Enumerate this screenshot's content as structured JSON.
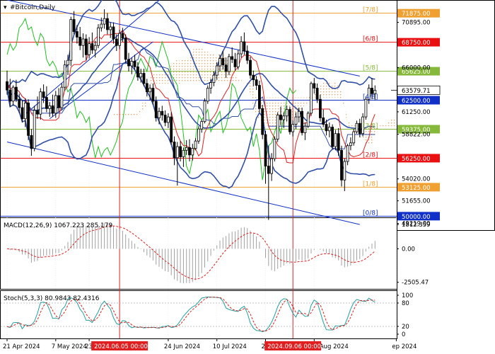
{
  "chart_data": {
    "type": "candlestick",
    "symbol_label": "#Bitcoin,Daily",
    "price_axis": {
      "range": [
        48500,
        73300
      ],
      "ticks": [
        "70895.00",
        "66000.00",
        "61250.00",
        "58822.00",
        "54020.00",
        "51655.00",
        "49219.00"
      ]
    },
    "murrey_levels": [
      {
        "label": "[7/8]",
        "price": 71875,
        "price_label": "71875.00",
        "color": "#f0a030"
      },
      {
        "label": "[6/8]",
        "price": 68750,
        "price_label": "68750.00",
        "color": "#e81010"
      },
      {
        "label": "[5/8]",
        "price": 65625,
        "price_label": "65625.00",
        "color": "#86b83a"
      },
      {
        "label": "[4/8]",
        "price": 62500,
        "price_label": "62500.00",
        "color": "#1030c8"
      },
      {
        "label": "[3/8]",
        "price": 59375,
        "price_label": "59375.00",
        "color": "#86b83a"
      },
      {
        "label": "[2/8]",
        "price": 56250,
        "price_label": "56250.00",
        "color": "#e81010"
      },
      {
        "label": "[1/8]",
        "price": 53125,
        "price_label": "53125.00",
        "color": "#f0a030"
      },
      {
        "label": "[0/8]",
        "price": 50000,
        "price_label": "50000.00",
        "color": "#1030c8"
      }
    ],
    "current_price": {
      "value": 63579.71,
      "label": "63579.71"
    },
    "trend_channel": [
      {
        "from": [
          0,
          73300
        ],
        "to": [
          116,
          65100
        ]
      },
      {
        "from": [
          0,
          58000
        ],
        "to": [
          116,
          49100
        ]
      }
    ],
    "x_axis": {
      "labels": [
        {
          "index": 0,
          "text": "21 Apr 2024"
        },
        {
          "index": 16,
          "text": "7 May 2024"
        },
        {
          "index": 27,
          "text": "23"
        },
        {
          "index": 53,
          "text": "24 Jun 2024"
        },
        {
          "index": 69,
          "text": "10 Jul 2024"
        },
        {
          "index": 85,
          "text": "26 Jul 2024"
        },
        {
          "index": 101,
          "text": "11 Aug 2024"
        },
        {
          "index": 128,
          "text": "ep 2024"
        }
      ],
      "highlighted": [
        {
          "index": 37,
          "text": "2024.06.05 00:00"
        },
        {
          "index": 94,
          "text": "2024.09.06 00:00"
        }
      ]
    },
    "candles": [
      {
        "o": 64500,
        "h": 65700,
        "l": 63100,
        "c": 63600
      },
      {
        "o": 63600,
        "h": 64800,
        "l": 61800,
        "c": 62400
      },
      {
        "o": 62400,
        "h": 64100,
        "l": 61900,
        "c": 63900
      },
      {
        "o": 63900,
        "h": 64700,
        "l": 62300,
        "c": 62600
      },
      {
        "o": 62600,
        "h": 63200,
        "l": 61100,
        "c": 61700
      },
      {
        "o": 61700,
        "h": 62500,
        "l": 60100,
        "c": 60500
      },
      {
        "o": 60500,
        "h": 62700,
        "l": 59600,
        "c": 62200
      },
      {
        "o": 62200,
        "h": 62600,
        "l": 58200,
        "c": 58700
      },
      {
        "o": 58700,
        "h": 59400,
        "l": 56500,
        "c": 57300
      },
      {
        "o": 57300,
        "h": 61900,
        "l": 57000,
        "c": 61400
      },
      {
        "o": 61400,
        "h": 62900,
        "l": 60500,
        "c": 61000
      },
      {
        "o": 61000,
        "h": 63800,
        "l": 60400,
        "c": 63400
      },
      {
        "o": 63400,
        "h": 64200,
        "l": 62200,
        "c": 62800
      },
      {
        "o": 62800,
        "h": 64000,
        "l": 61200,
        "c": 61600
      },
      {
        "o": 61600,
        "h": 62300,
        "l": 60700,
        "c": 61900
      },
      {
        "o": 61900,
        "h": 63100,
        "l": 60700,
        "c": 61100
      },
      {
        "o": 61100,
        "h": 63500,
        "l": 60600,
        "c": 63000
      },
      {
        "o": 63000,
        "h": 63800,
        "l": 61200,
        "c": 61700
      },
      {
        "o": 61700,
        "h": 64300,
        "l": 61400,
        "c": 63900
      },
      {
        "o": 63900,
        "h": 66800,
        "l": 63500,
        "c": 66300
      },
      {
        "o": 66300,
        "h": 67400,
        "l": 65200,
        "c": 66800
      },
      {
        "o": 66800,
        "h": 71500,
        "l": 66200,
        "c": 71200
      },
      {
        "o": 71200,
        "h": 72100,
        "l": 69600,
        "c": 69900
      },
      {
        "o": 69900,
        "h": 70600,
        "l": 68600,
        "c": 69300
      },
      {
        "o": 69300,
        "h": 70400,
        "l": 67900,
        "c": 68400
      },
      {
        "o": 68400,
        "h": 69700,
        "l": 67100,
        "c": 69100
      },
      {
        "o": 69100,
        "h": 69600,
        "l": 66800,
        "c": 67400
      },
      {
        "o": 67400,
        "h": 69300,
        "l": 67000,
        "c": 68600
      },
      {
        "o": 68600,
        "h": 69800,
        "l": 67500,
        "c": 67900
      },
      {
        "o": 67900,
        "h": 68900,
        "l": 67100,
        "c": 68400
      },
      {
        "o": 68400,
        "h": 70700,
        "l": 68100,
        "c": 70300
      },
      {
        "o": 70300,
        "h": 71400,
        "l": 69900,
        "c": 70700
      },
      {
        "o": 70700,
        "h": 72300,
        "l": 70200,
        "c": 71300
      },
      {
        "o": 71300,
        "h": 71900,
        "l": 69600,
        "c": 70100
      },
      {
        "o": 70100,
        "h": 70900,
        "l": 69200,
        "c": 70400
      },
      {
        "o": 70400,
        "h": 70900,
        "l": 68600,
        "c": 69100
      },
      {
        "o": 69100,
        "h": 69600,
        "l": 67800,
        "c": 68400
      },
      {
        "o": 68400,
        "h": 70100,
        "l": 68000,
        "c": 69700
      },
      {
        "o": 69700,
        "h": 70300,
        "l": 68800,
        "c": 69200
      },
      {
        "o": 69200,
        "h": 69600,
        "l": 66500,
        "c": 66900
      },
      {
        "o": 66900,
        "h": 67600,
        "l": 65600,
        "c": 66200
      },
      {
        "o": 66200,
        "h": 67100,
        "l": 65300,
        "c": 66700
      },
      {
        "o": 66700,
        "h": 67400,
        "l": 65800,
        "c": 66100
      },
      {
        "o": 66100,
        "h": 66600,
        "l": 64600,
        "c": 65000
      },
      {
        "o": 65000,
        "h": 65900,
        "l": 64400,
        "c": 65400
      },
      {
        "o": 65400,
        "h": 65900,
        "l": 64000,
        "c": 64300
      },
      {
        "o": 64300,
        "h": 64800,
        "l": 62900,
        "c": 63400
      },
      {
        "o": 63400,
        "h": 64200,
        "l": 62500,
        "c": 63800
      },
      {
        "o": 63800,
        "h": 64300,
        "l": 62000,
        "c": 62400
      },
      {
        "o": 62400,
        "h": 62900,
        "l": 60200,
        "c": 60600
      },
      {
        "o": 60600,
        "h": 61700,
        "l": 59900,
        "c": 61300
      },
      {
        "o": 61300,
        "h": 61900,
        "l": 60300,
        "c": 60900
      },
      {
        "o": 60900,
        "h": 61400,
        "l": 59700,
        "c": 60100
      },
      {
        "o": 60100,
        "h": 61100,
        "l": 59500,
        "c": 60700
      },
      {
        "o": 60700,
        "h": 61200,
        "l": 57700,
        "c": 58000
      },
      {
        "o": 58000,
        "h": 58600,
        "l": 55500,
        "c": 56300
      },
      {
        "o": 56300,
        "h": 58000,
        "l": 53300,
        "c": 57500
      },
      {
        "o": 57500,
        "h": 58100,
        "l": 55900,
        "c": 56400
      },
      {
        "o": 56400,
        "h": 57400,
        "l": 55300,
        "c": 57100
      },
      {
        "o": 57100,
        "h": 58200,
        "l": 56600,
        "c": 57400
      },
      {
        "o": 57400,
        "h": 58300,
        "l": 55900,
        "c": 56600
      },
      {
        "o": 56600,
        "h": 57800,
        "l": 56000,
        "c": 57300
      },
      {
        "o": 57300,
        "h": 58400,
        "l": 57100,
        "c": 58100
      },
      {
        "o": 58100,
        "h": 59700,
        "l": 57800,
        "c": 59400
      },
      {
        "o": 59400,
        "h": 60400,
        "l": 59000,
        "c": 60200
      },
      {
        "o": 60200,
        "h": 62700,
        "l": 60000,
        "c": 62400
      },
      {
        "o": 62400,
        "h": 64100,
        "l": 62100,
        "c": 63800
      },
      {
        "o": 63800,
        "h": 64800,
        "l": 63200,
        "c": 64400
      },
      {
        "o": 64400,
        "h": 65600,
        "l": 64000,
        "c": 65200
      },
      {
        "o": 65200,
        "h": 66600,
        "l": 64700,
        "c": 66200
      },
      {
        "o": 66200,
        "h": 67400,
        "l": 65600,
        "c": 67000
      },
      {
        "o": 67000,
        "h": 67800,
        "l": 65800,
        "c": 66300
      },
      {
        "o": 66300,
        "h": 67100,
        "l": 64900,
        "c": 65600
      },
      {
        "o": 65600,
        "h": 67500,
        "l": 65200,
        "c": 67200
      },
      {
        "o": 67200,
        "h": 68200,
        "l": 66500,
        "c": 66900
      },
      {
        "o": 66900,
        "h": 67600,
        "l": 65700,
        "c": 66100
      },
      {
        "o": 66100,
        "h": 67900,
        "l": 65800,
        "c": 67500
      },
      {
        "o": 67500,
        "h": 69400,
        "l": 67100,
        "c": 68800
      },
      {
        "o": 68800,
        "h": 69800,
        "l": 67400,
        "c": 67800
      },
      {
        "o": 67800,
        "h": 68400,
        "l": 66400,
        "c": 66800
      },
      {
        "o": 66800,
        "h": 67200,
        "l": 64800,
        "c": 65200
      },
      {
        "o": 65200,
        "h": 65700,
        "l": 64000,
        "c": 64700
      },
      {
        "o": 64700,
        "h": 65100,
        "l": 63600,
        "c": 64100
      },
      {
        "o": 64100,
        "h": 64600,
        "l": 61200,
        "c": 61600
      },
      {
        "o": 61600,
        "h": 62000,
        "l": 58300,
        "c": 58800
      },
      {
        "o": 58800,
        "h": 59200,
        "l": 53500,
        "c": 55400
      },
      {
        "o": 55400,
        "h": 57600,
        "l": 49600,
        "c": 54600
      },
      {
        "o": 54600,
        "h": 56800,
        "l": 53800,
        "c": 56200
      },
      {
        "o": 56200,
        "h": 58600,
        "l": 55900,
        "c": 58300
      },
      {
        "o": 58300,
        "h": 61200,
        "l": 58000,
        "c": 60900
      },
      {
        "o": 60900,
        "h": 61800,
        "l": 59800,
        "c": 60400
      },
      {
        "o": 60400,
        "h": 61200,
        "l": 59500,
        "c": 60800
      },
      {
        "o": 60800,
        "h": 61900,
        "l": 60200,
        "c": 61500
      },
      {
        "o": 61500,
        "h": 61800,
        "l": 58800,
        "c": 59100
      },
      {
        "o": 59100,
        "h": 60300,
        "l": 58600,
        "c": 59900
      },
      {
        "o": 59900,
        "h": 61200,
        "l": 59400,
        "c": 60700
      },
      {
        "o": 60700,
        "h": 61700,
        "l": 60100,
        "c": 61300
      },
      {
        "o": 61300,
        "h": 61700,
        "l": 58700,
        "c": 59000
      },
      {
        "o": 59000,
        "h": 60100,
        "l": 58200,
        "c": 59700
      },
      {
        "o": 59700,
        "h": 61300,
        "l": 59500,
        "c": 61100
      },
      {
        "o": 61100,
        "h": 64500,
        "l": 60800,
        "c": 64300
      },
      {
        "o": 64300,
        "h": 64900,
        "l": 63200,
        "c": 63800
      },
      {
        "o": 63800,
        "h": 64300,
        "l": 62200,
        "c": 62600
      },
      {
        "o": 62600,
        "h": 63100,
        "l": 60200,
        "c": 60600
      },
      {
        "o": 60600,
        "h": 61500,
        "l": 59600,
        "c": 59900
      },
      {
        "o": 59900,
        "h": 60400,
        "l": 58700,
        "c": 59200
      },
      {
        "o": 59200,
        "h": 60100,
        "l": 58500,
        "c": 59600
      },
      {
        "o": 59600,
        "h": 59900,
        "l": 57200,
        "c": 57500
      },
      {
        "o": 57500,
        "h": 59300,
        "l": 57100,
        "c": 58900
      },
      {
        "o": 58900,
        "h": 59500,
        "l": 56500,
        "c": 57100
      },
      {
        "o": 57100,
        "h": 57600,
        "l": 53200,
        "c": 53900
      },
      {
        "o": 53900,
        "h": 56200,
        "l": 52700,
        "c": 55900
      },
      {
        "o": 55900,
        "h": 57800,
        "l": 55500,
        "c": 57600
      },
      {
        "o": 57600,
        "h": 58500,
        "l": 57100,
        "c": 57900
      },
      {
        "o": 57900,
        "h": 59400,
        "l": 57600,
        "c": 59100
      },
      {
        "o": 59100,
        "h": 60300,
        "l": 58900,
        "c": 60000
      },
      {
        "o": 60000,
        "h": 60500,
        "l": 58500,
        "c": 58900
      },
      {
        "o": 58900,
        "h": 61100,
        "l": 58600,
        "c": 60700
      },
      {
        "o": 60700,
        "h": 62900,
        "l": 60400,
        "c": 62600
      },
      {
        "o": 62600,
        "h": 64200,
        "l": 62100,
        "c": 63800
      },
      {
        "o": 63800,
        "h": 64900,
        "l": 62600,
        "c": 63200
      },
      {
        "o": 63200,
        "h": 64100,
        "l": 62500,
        "c": 63580
      }
    ],
    "macd": {
      "label": "MACD(12,26,9) 1067.223 285.179",
      "params": [
        12,
        26,
        9
      ],
      "main": 1067.223,
      "signal": 285.179,
      "axis_ticks": [
        "1812.359",
        "0.00",
        "-2505.47"
      ],
      "range": [
        -3000,
        2300
      ],
      "zero": 0
    },
    "stochastic": {
      "label": "Stoch(5,3,3) 80.9843 82.4316",
      "params": [
        5,
        3,
        3
      ],
      "main": 80.9843,
      "signal": 82.4316,
      "axis_ticks": [
        "100",
        "80",
        "20",
        "0"
      ],
      "range": [
        0,
        100
      ],
      "levels": [
        80,
        20
      ]
    },
    "colors": {
      "bollinger": "#3050a8",
      "ichimoku_tenkan": "#e02020",
      "ichimoku_kijun": "#3050a8",
      "ichimoku_chikou": "#20c020",
      "kumo": "#e7a060",
      "stoch_main": "#20a0a0",
      "stoch_signal": "#e02020",
      "macd_hist": "#a0a0a0",
      "macd_signal": "#e02020",
      "highlight_line": "#e02020",
      "highlight_box": "#e02020"
    }
  }
}
